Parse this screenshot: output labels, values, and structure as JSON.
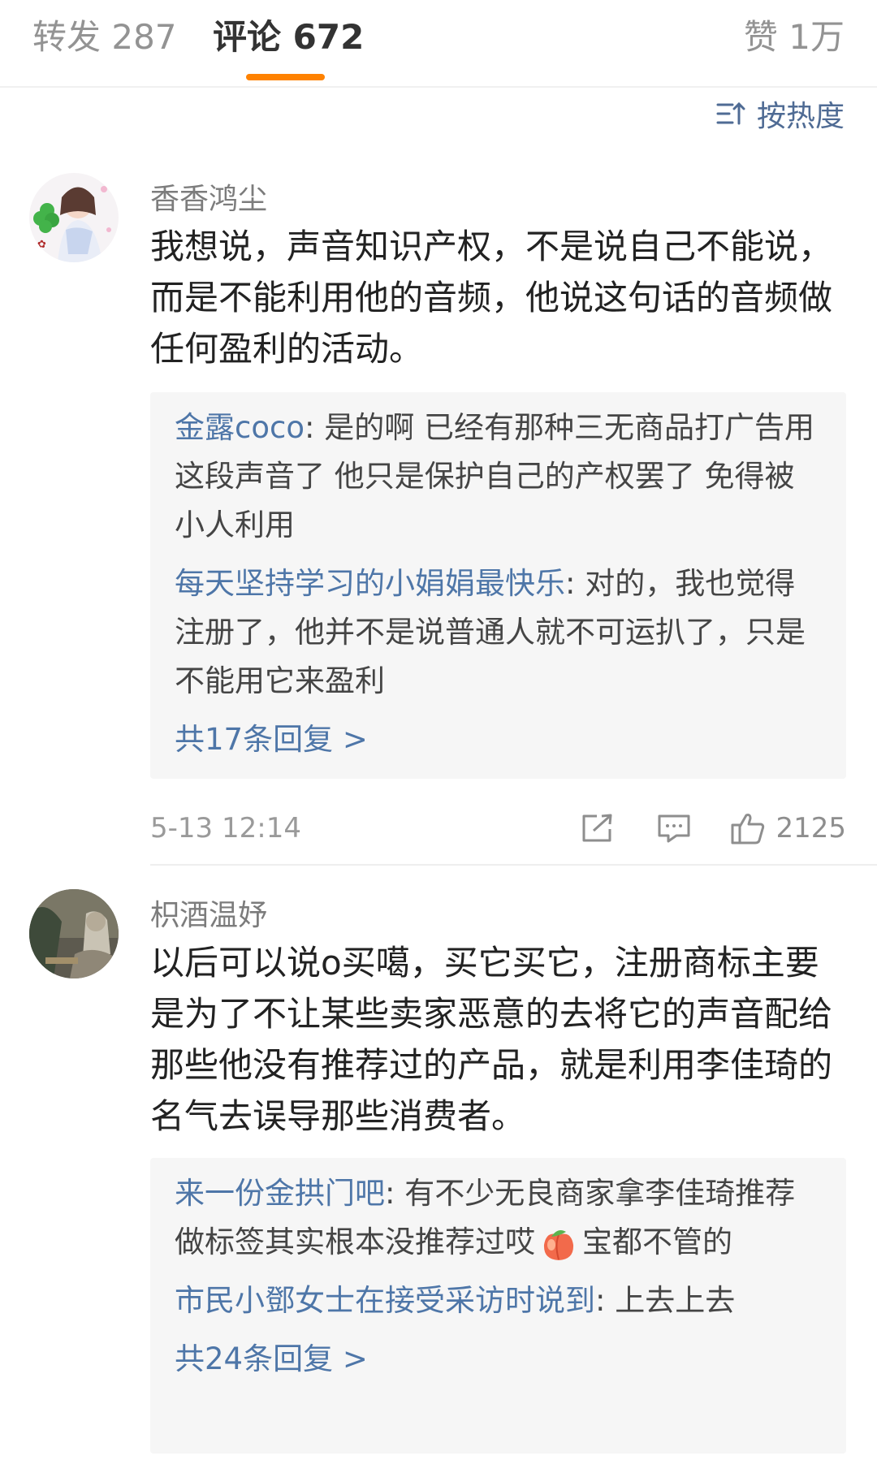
{
  "tabs": {
    "repost": "转发 287",
    "comments": "评论 672",
    "likes": "赞 1万"
  },
  "sort": {
    "label": "按热度",
    "icon": "sort-icon"
  },
  "comments": [
    {
      "username": "香香鸿尘",
      "text": "我想说，声音知识产权，不是说自己不能说，而是不能利用他的音频，他说这句话的音频做任何盈利的活动。",
      "replies": [
        {
          "name": "金露coco",
          "text": ": 是的啊 已经有那种三无商品打广告用这段声音了 他只是保护自己的产权罢了 免得被小人利用"
        },
        {
          "name": "每天坚持学习的小娟娟最快乐",
          "text": ": 对的，我也觉得注册了，他并不是说普通人就不可运扒了，只是不能用它来盈利"
        }
      ],
      "more": "共17条回复 >",
      "time": "5-13 12:14",
      "like_count": "2125"
    },
    {
      "username": "枳酒温妤",
      "text": "以后可以说o买噶，买它买它，注册商标主要是为了不让某些卖家恶意的去将它的声音配给那些他没有推荐过的产品，就是利用李佳琦的名气去误导那些消费者。",
      "replies": [
        {
          "name": "来一份金拱门吧",
          "text_a": ": 有不少无良商家拿李佳琦推荐做标签其实根本没推荐过哎",
          "text_b": "宝都不管的"
        },
        {
          "name": "市民小鄧女士在接受采访时说到",
          "text": ": 上去上去"
        }
      ],
      "more": "共24条回复 >"
    }
  ],
  "colors": {
    "accent": "#ff8200",
    "link": "#4e76a8",
    "sort": "#4f6b94"
  }
}
